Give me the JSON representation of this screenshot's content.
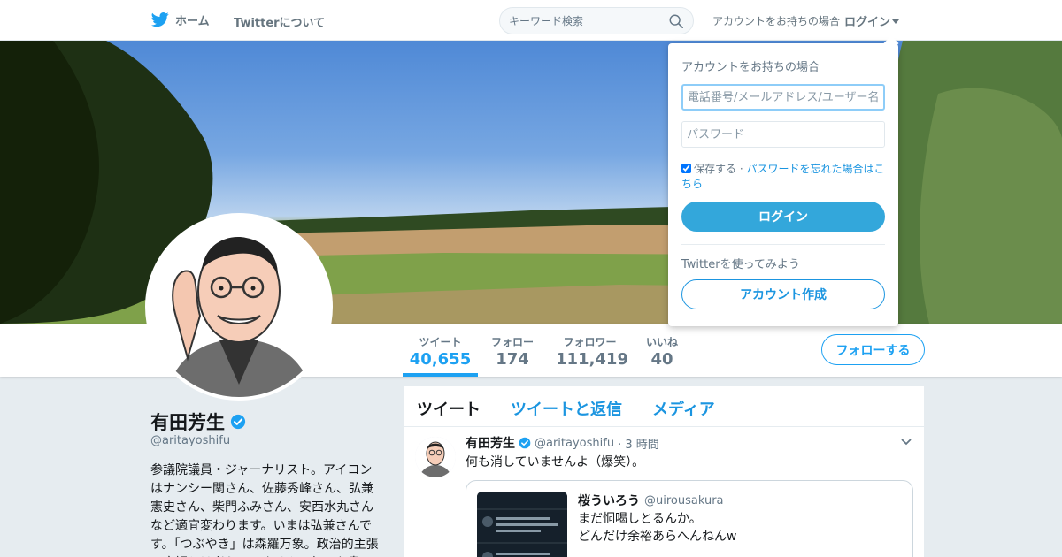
{
  "nav": {
    "home_label": "ホーム",
    "about_label": "Twitterについて",
    "search_placeholder": "キーワード検索",
    "have_account_text": "アカウントをお持ちの場合",
    "login_label": "ログイン"
  },
  "profile": {
    "name": "有田芳生",
    "handle": "@aritayoshifu",
    "bio": "参議院議員・ジャーナリスト。アイコンはナンシー関さん、佐藤秀峰さん、弘兼憲史さん、柴門ふみさん、安西水丸さんなど適宜変わります。いまは弘兼さんです。「つぶやき」は森羅万象。政治的主張の容認とは考えていません。何でも書",
    "follow_button": "フォローする"
  },
  "stats": [
    {
      "label": "ツイート",
      "value": "40,655",
      "active": true
    },
    {
      "label": "フォロー",
      "value": "174"
    },
    {
      "label": "フォロワー",
      "value": "111,419"
    },
    {
      "label": "いいね",
      "value": "40"
    }
  ],
  "tabs": [
    {
      "label": "ツイート",
      "active": true
    },
    {
      "label": "ツイートと返信"
    },
    {
      "label": "メディア"
    }
  ],
  "tweet": {
    "name": "有田芳生",
    "handle": "@aritayoshifu",
    "time": "· 3 時間",
    "text": "何も消していませんよ（爆笑）。",
    "quote": {
      "name": "桜ういろう",
      "handle": "@uirousakura",
      "text": "まだ恫喝しとるんか。\nどんだけ余裕あらへんねんw"
    }
  },
  "login_dropdown": {
    "title": "アカウントをお持ちの場合",
    "username_placeholder": "電話番号/メールアドレス/ユーザー名",
    "password_placeholder": "パスワード",
    "remember_label": "保存する",
    "separator": "·",
    "forgot_label": "パスワードを忘れた場合はこちら",
    "login_button": "ログイン",
    "try_text": "Twitterを使ってみよう",
    "create_button": "アカウント作成"
  },
  "colors": {
    "accent": "#1da1f2",
    "link": "#1b95e0",
    "login_button_bg": "#33a7db",
    "verified": "#1da1f2"
  }
}
